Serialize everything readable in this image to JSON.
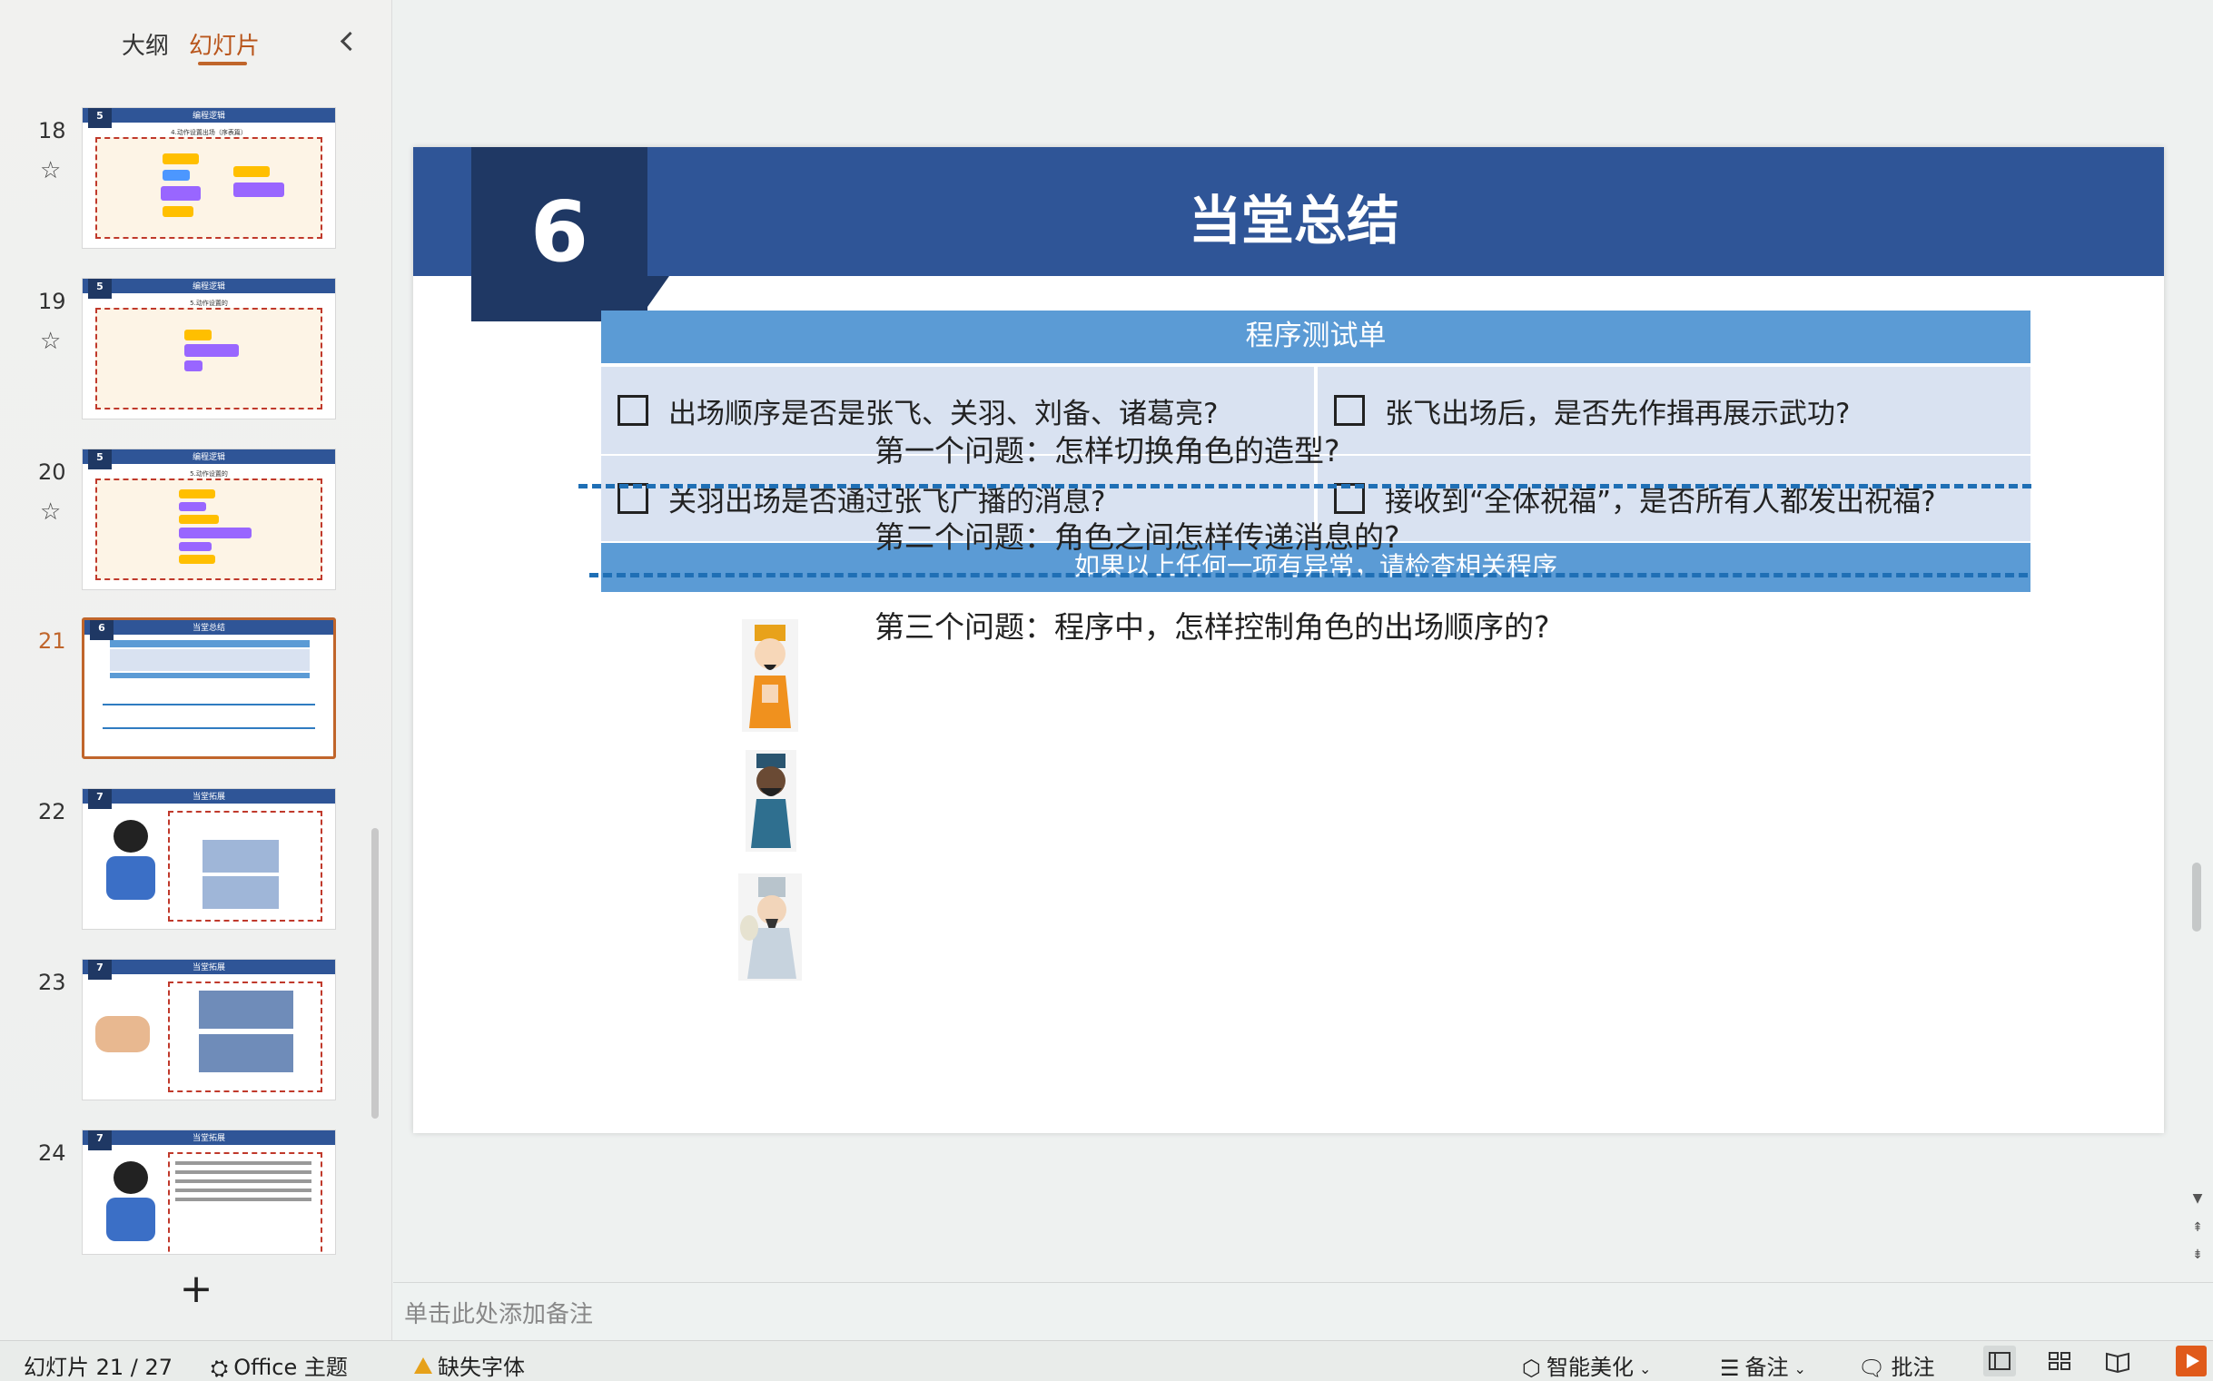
{
  "panel": {
    "tab_outline": "大纲",
    "tab_slides": "幻灯片",
    "add_slide": "+"
  },
  "thumbnails": [
    {
      "number": "18",
      "badge": "5",
      "title": "编程逻辑",
      "subtitle": "4.动作设置出场（序表篇）"
    },
    {
      "number": "19",
      "badge": "5",
      "title": "编程逻辑",
      "subtitle": "5.动作设置的"
    },
    {
      "number": "20",
      "badge": "5",
      "title": "编程逻辑",
      "subtitle": "5.动作设置的"
    },
    {
      "number": "21",
      "badge": "6",
      "title": "当堂总结",
      "subtitle": "程序测试单"
    },
    {
      "number": "22",
      "badge": "7",
      "title": "当堂拓展",
      "subtitle": ""
    },
    {
      "number": "23",
      "badge": "7",
      "title": "当堂拓展",
      "subtitle": ""
    },
    {
      "number": "24",
      "badge": "7",
      "title": "当堂拓展",
      "subtitle": ""
    }
  ],
  "slide": {
    "section_number": "6",
    "title": "当堂总结",
    "checklist_title": "程序测试单",
    "checks": [
      "出场顺序是否是张飞、关羽、刘备、诸葛亮?",
      "张飞出场后，是否先作揖再展示武功?",
      "关羽出场是否通过张飞广播的消息?",
      "接收到“全体祝福”，是否所有人都发出祝福?"
    ],
    "checklist_footer": "如果以上任何一项有异常，请检查相关程序",
    "questions": [
      "第一个问题：怎样切换角色的造型?",
      "第二个问题：角色之间怎样传递消息的?",
      "第三个问题：程序中，怎样控制角色的出场顺序的?"
    ]
  },
  "notes": {
    "placeholder": "单击此处添加备注"
  },
  "status": {
    "slide_counter": "幻灯片 21 / 27",
    "theme": "Office 主题",
    "missing_font": "缺失字体",
    "smart_beautify": "智能美化",
    "notes": "备注",
    "comments": "批注"
  },
  "colors": {
    "header_blue": "#2f5597",
    "dark_blue": "#1f3864",
    "light_blue": "#5b9bd5",
    "cell_blue": "#d9e2f1",
    "accent_orange": "#c0652b"
  }
}
